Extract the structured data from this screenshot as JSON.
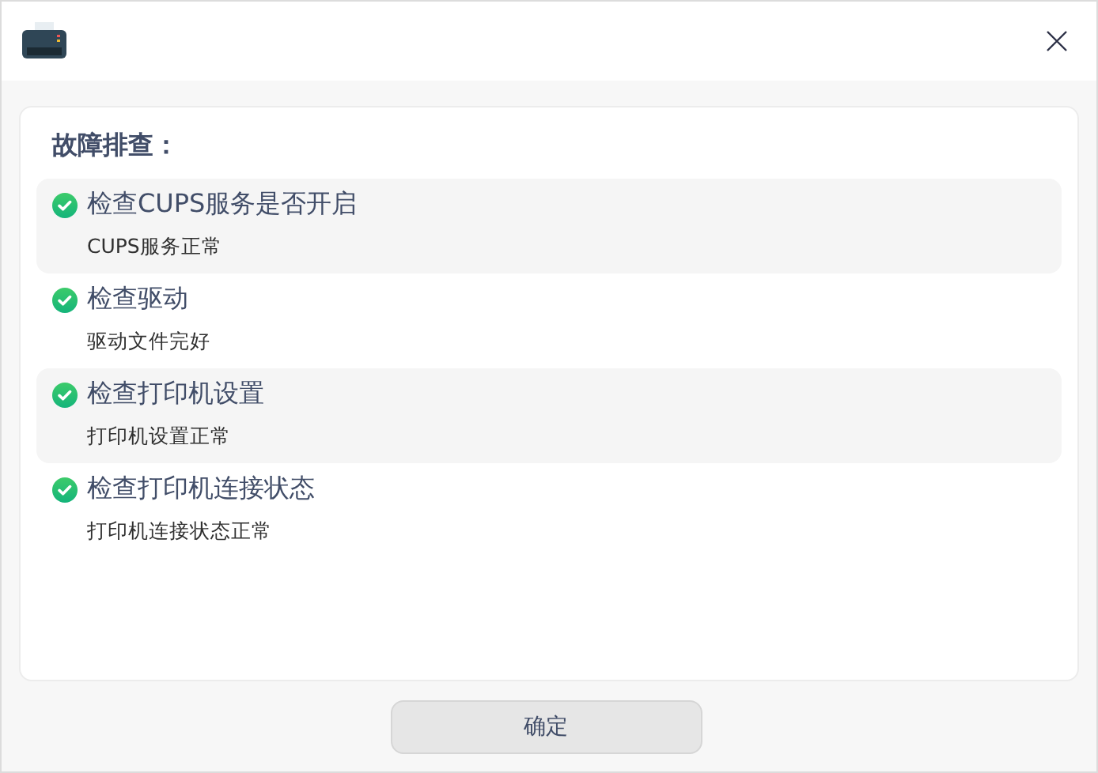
{
  "title": "故障排查：",
  "checks": [
    {
      "passed": true,
      "name": "检查CUPS服务是否开启",
      "result": "CUPS服务正常"
    },
    {
      "passed": true,
      "name": "检查驱动",
      "result": "驱动文件完好"
    },
    {
      "passed": true,
      "name": "检查打印机设置",
      "result": "打印机设置正常"
    },
    {
      "passed": true,
      "name": "检查打印机连接状态",
      "result": "打印机连接状态正常"
    }
  ],
  "buttons": [
    "确定"
  ]
}
